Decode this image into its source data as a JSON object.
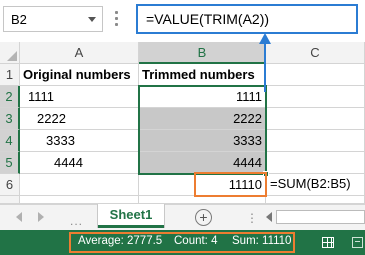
{
  "formula_bar": {
    "name_box": "B2",
    "formula": "=VALUE(TRIM(A2))"
  },
  "columns": [
    "A",
    "B",
    "C"
  ],
  "rows": [
    "1",
    "2",
    "3",
    "4",
    "5",
    "6"
  ],
  "cells": {
    "a1": "Original numbers",
    "b1": "Trimmed numbers",
    "a2": "1111",
    "a3": "2222",
    "a4": "3333",
    "a5": "4444",
    "b2": "1111",
    "b3": "2222",
    "b4": "3333",
    "b5": "4444",
    "b6": "11110"
  },
  "annotation": {
    "sum_formula": "=SUM(B2:B5)"
  },
  "sheets": {
    "active": "Sheet1",
    "add_symbol": "+",
    "more": "..."
  },
  "status_bar": {
    "average": "Average: 2777.5",
    "count": "Count: 4",
    "sum": "Sum: 11110"
  },
  "colors": {
    "accent": "#217346",
    "highlight": "#ed7d31",
    "formula_focus": "#2b7cd3"
  }
}
